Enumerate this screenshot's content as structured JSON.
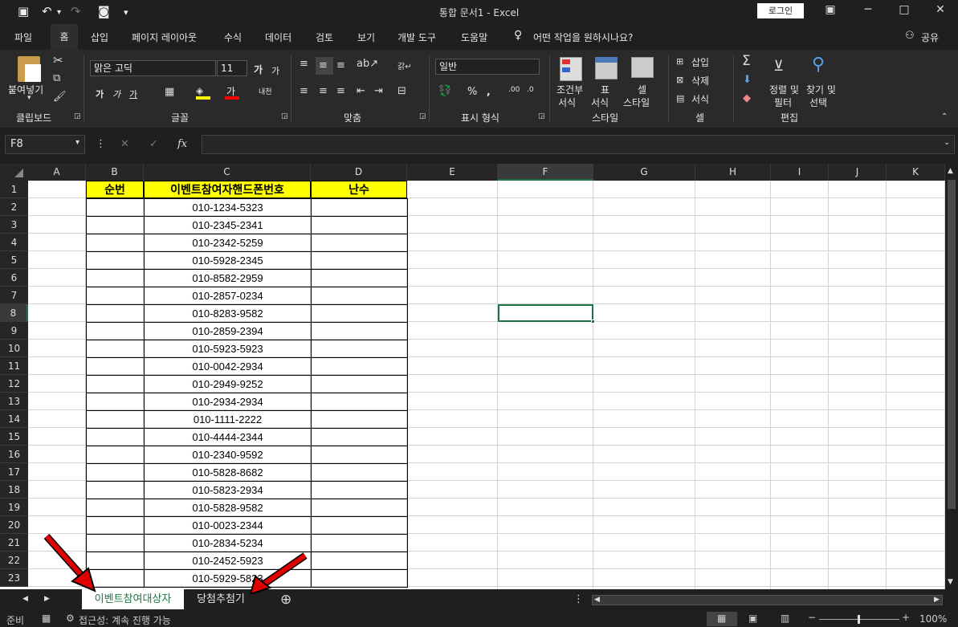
{
  "title": "통합 문서1  -  Excel",
  "login_label": "로그인",
  "window": {
    "ribbon_opts": "▣",
    "minimize": "─",
    "maximize": "□",
    "close": "✕"
  },
  "qat": {
    "save": "💾",
    "undo": "↶",
    "redo": "↷",
    "camera": "📷",
    "more": "▾"
  },
  "menu": [
    "파일",
    "홈",
    "삽입",
    "페이지 레이아웃",
    "수식",
    "데이터",
    "검토",
    "보기",
    "개발 도구",
    "도움말"
  ],
  "tellme": "어떤 작업을 원하시나요?",
  "share": "공유",
  "ribbon": {
    "paste": "붙여넣기",
    "clipboard": "클립보드",
    "font_name": "맑은 고딕",
    "font_size": "11",
    "font_group": "글꼴",
    "align_group": "맞춤",
    "number_format": "일반",
    "number_group": "표시 형식",
    "cond_format_1": "조건부",
    "cond_format_2": "서식",
    "table_format_1": "표",
    "table_format_2": "서식",
    "cell_style_1": "셀",
    "cell_style_2": "스타일",
    "style_group": "스타일",
    "insert": "삽입",
    "delete": "삭제",
    "format": "서식",
    "cells_group": "셀",
    "sort_1": "정렬 및",
    "sort_2": "필터",
    "find_1": "찾기 및",
    "find_2": "선택",
    "edit_group": "편집"
  },
  "namebox": "F8",
  "fx": "fx",
  "columns": [
    "A",
    "B",
    "C",
    "D",
    "E",
    "F",
    "G",
    "H",
    "I",
    "J",
    "K"
  ],
  "header_row": {
    "b": "순번",
    "c": "이벤트참여자핸드폰번호",
    "d": "난수"
  },
  "phones": [
    "010-1234-5323",
    "010-2345-2341",
    "010-2342-5259",
    "010-5928-2345",
    "010-8582-2959",
    "010-2857-0234",
    "010-8283-9582",
    "010-2859-2394",
    "010-5923-5923",
    "010-0042-2934",
    "010-2949-9252",
    "010-2934-2934",
    "010-1111-2222",
    "010-4444-2344",
    "010-2340-9592",
    "010-5828-8682",
    "010-5823-2934",
    "010-5828-9582",
    "010-0023-2344",
    "010-2834-5234",
    "010-2452-5923",
    "010-5929-5823"
  ],
  "row_numbers": [
    "1",
    "2",
    "3",
    "4",
    "5",
    "6",
    "7",
    "8",
    "9",
    "10",
    "11",
    "12",
    "13",
    "14",
    "15",
    "16",
    "17",
    "18",
    "19",
    "20",
    "21",
    "22",
    "23"
  ],
  "sheets": [
    "이벤트참여대상자",
    "당첨추첨기"
  ],
  "add_sheet": "⊕",
  "status": {
    "ready": "준비",
    "accessibility": "접근성: 계속 진행 가능",
    "zoom": "100%"
  },
  "colors": {
    "header_fill": "#ffff00",
    "selection": "#217346",
    "dark_bg": "#1f1f1f",
    "arrow": "#e00000"
  }
}
